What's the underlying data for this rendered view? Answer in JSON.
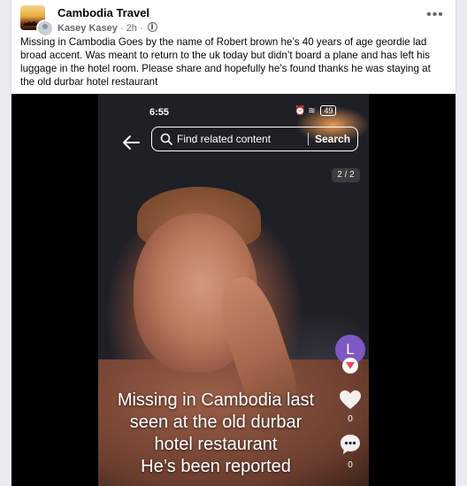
{
  "post": {
    "page_name": "Cambodia Travel",
    "author": "Kasey Kasey",
    "time": "2h",
    "caption": "Missing in Cambodia Goes by the name of Robert brown he’s 40 years of age geordie lad broad accent. Was meant to return to the uk today but didn’t board a plane and has left his luggage in the hotel room. Please share and hopefully he’s found thanks he was staying at the old durbar hotel restaurant"
  },
  "screenshot": {
    "status_time": "6:55",
    "battery": "49",
    "search_placeholder": "Find related content",
    "search_button": "Search",
    "page_counter": "2 / 2",
    "profile_initial": "L",
    "like_count": "0",
    "comment_count": "0",
    "overlay_lines": [
      "Missing in Cambodia last",
      "seen at the old durbar",
      "hotel restaurant",
      "He’s been reported"
    ]
  },
  "icons": [
    "more-options-icon",
    "globe-icon",
    "back-arrow-icon",
    "search-icon",
    "heart-icon",
    "comment-icon",
    "follow-plus-icon"
  ],
  "colors": {
    "profile_avatar": "#7e57c2",
    "follow_badge": "#ff3b5c"
  }
}
